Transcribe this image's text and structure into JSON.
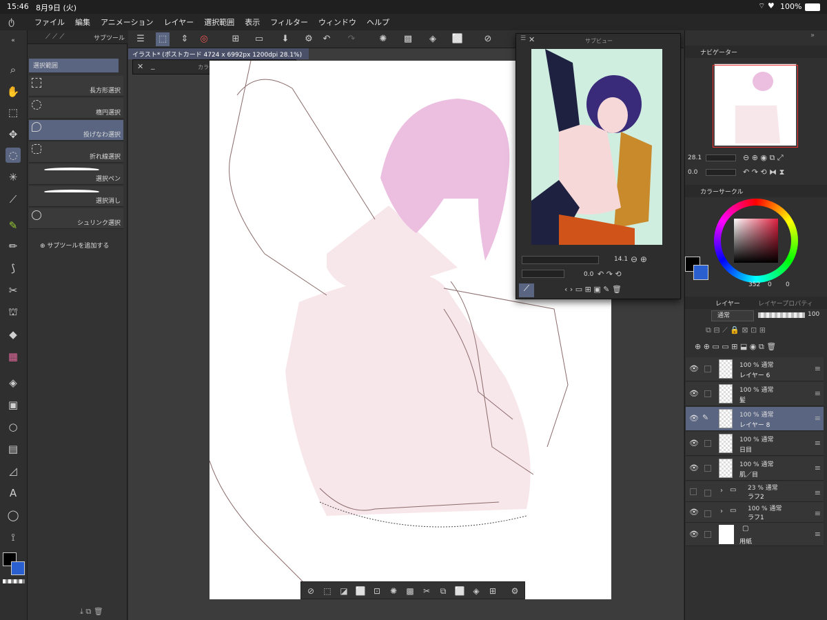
{
  "status": {
    "time": "15:46",
    "date": "8月9日 (火)",
    "battery": "100%"
  },
  "menu": [
    "ファイル",
    "編集",
    "アニメーション",
    "レイヤー",
    "選択範囲",
    "表示",
    "フィルター",
    "ウィンドウ",
    "ヘルプ"
  ],
  "subtool": {
    "tab": "サブツール",
    "header": "選択範囲",
    "items": [
      "長方形選択",
      "楕円選択",
      "投げなわ選択",
      "折れ線選択",
      "選択ペン",
      "選択消し",
      "シュリンク選択"
    ],
    "add": "サブツールを追加する"
  },
  "file_tab": "イラスト* (ポストカード 4724 x 6992px 1200dpi 28.1%)",
  "colorset_title": "カラーセット",
  "subview": {
    "title": "サブビュー",
    "zoom": "14.1",
    "angle": "0.0"
  },
  "navigator": {
    "title": "ナビゲーター",
    "zoom": "28.1",
    "angle": "0.0"
  },
  "color_circle": {
    "title": "カラーサークル",
    "h": "352",
    "s": "0",
    "v": "0",
    "main_color": "#000000",
    "sub_color": "#2a5fd0"
  },
  "layers": {
    "tab1": "レイヤー",
    "tab2": "レイヤープロパティ",
    "blend": "通常",
    "opacity": "100",
    "rows": [
      {
        "opacity": "100 %  通常",
        "name": "レイヤー 6"
      },
      {
        "opacity": "100 %  通常",
        "name": "髪"
      },
      {
        "opacity": "100 %  通常",
        "name": "レイヤー 8"
      },
      {
        "opacity": "100 %  通常",
        "name": "日目"
      },
      {
        "opacity": "100 %  通常",
        "name": "肌／目"
      },
      {
        "opacity": "23 %  通常",
        "name": "ラフ2"
      },
      {
        "opacity": "100 %  通常",
        "name": "ラフ1"
      },
      {
        "opacity": "",
        "name": "用紙"
      }
    ]
  }
}
